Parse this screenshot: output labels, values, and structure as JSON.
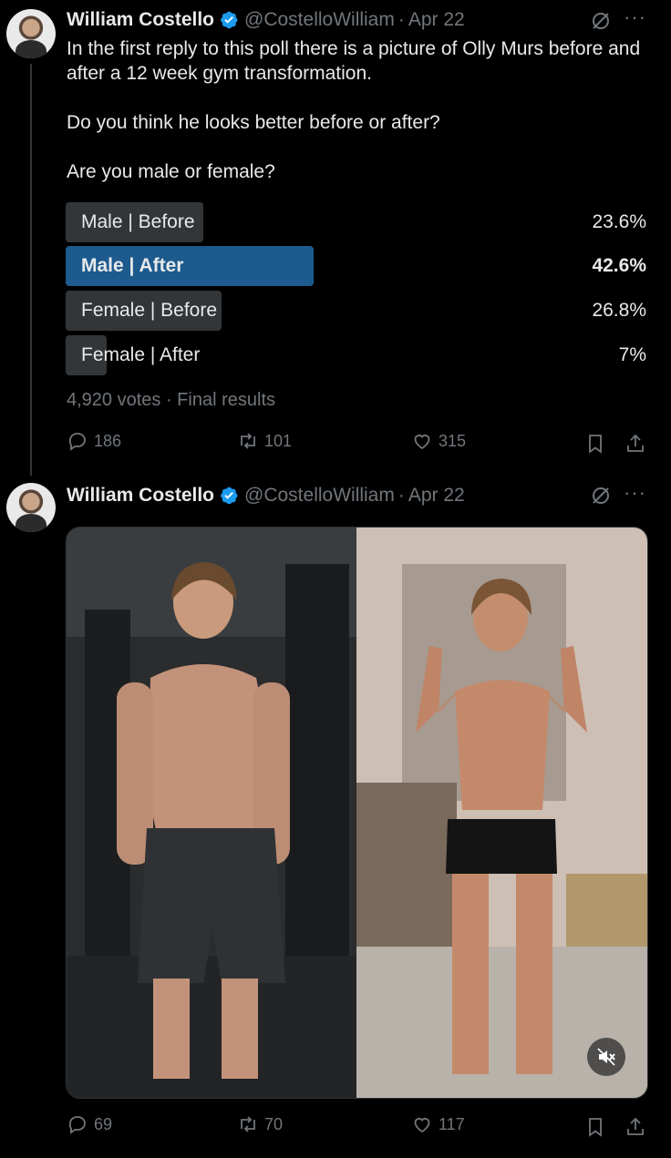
{
  "tweets": [
    {
      "author": {
        "name": "William Costello",
        "handle": "@CostelloWilliam",
        "date": "Apr 22",
        "separator": "·"
      },
      "text": "In the first reply to this poll there is a picture of Olly Murs before and after a 12 week gym transformation.\n\nDo you think he looks better before or after?\n\nAre you male or female?",
      "poll": {
        "options": [
          {
            "label": "Male | Before",
            "percent": "23.6%",
            "share": 0.236
          },
          {
            "label": "Male | After",
            "percent": "42.6%",
            "share": 0.426,
            "winner": true
          },
          {
            "label": "Female | Before",
            "percent": "26.8%",
            "share": 0.268
          },
          {
            "label": "Female | After",
            "percent": "7%",
            "share": 0.07
          }
        ],
        "meta": "4,920 votes · Final results"
      },
      "actions": {
        "replies": "186",
        "reposts": "101",
        "likes": "315"
      }
    },
    {
      "author": {
        "name": "William Costello",
        "handle": "@CostelloWilliam",
        "date": "Apr 22",
        "separator": "·"
      },
      "media": {
        "description_icon": "photo",
        "mute_icon": "speaker-muted-icon"
      },
      "actions": {
        "replies": "69",
        "reposts": "70",
        "likes": "117"
      }
    }
  ],
  "colors": {
    "accent": "#1d9bf0",
    "winner_bar": "#1d5a8e",
    "bar": "#333639",
    "muted": "#71767b"
  }
}
